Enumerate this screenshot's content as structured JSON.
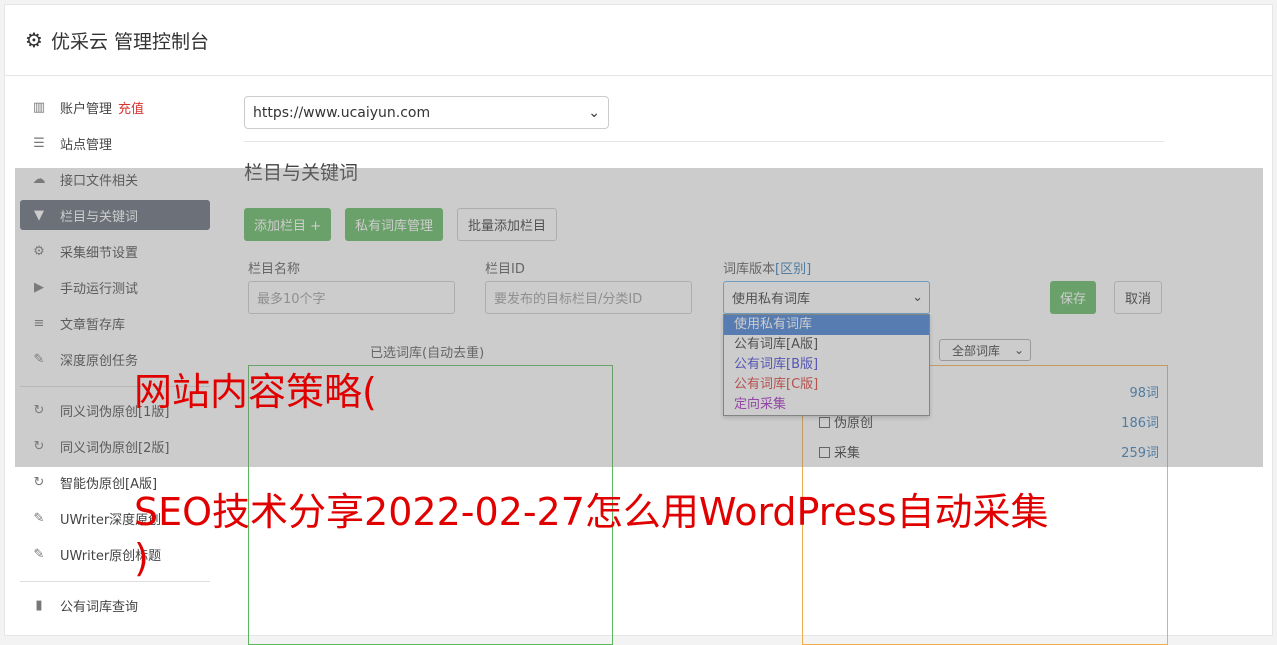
{
  "header": {
    "title": "优采云 管理控制台"
  },
  "sidebar": {
    "items": [
      {
        "label": "账户管理",
        "extra": "充值",
        "icon": "bar-chart-icon"
      },
      {
        "label": "站点管理",
        "icon": "server-icon"
      },
      {
        "label": "接口文件相关",
        "icon": "cloud-upload-icon"
      },
      {
        "label": "栏目与关键词",
        "icon": "filter-icon"
      },
      {
        "label": "采集细节设置",
        "icon": "gears-icon"
      },
      {
        "label": "手动运行测试",
        "icon": "play-circle-icon"
      },
      {
        "label": "文章暂存库",
        "icon": "database-icon"
      },
      {
        "label": "深度原创任务",
        "icon": "edit-icon"
      },
      {
        "label": "同义词伪原创[1版]",
        "icon": "refresh-icon"
      },
      {
        "label": "同义词伪原创[2版]",
        "icon": "refresh-icon"
      },
      {
        "label": "智能伪原创[A版]",
        "icon": "refresh-icon"
      },
      {
        "label": "UWriter深度原创",
        "icon": "edit-icon"
      },
      {
        "label": "UWriter原创标题",
        "icon": "edit-icon"
      },
      {
        "label": "公有词库查询",
        "icon": "book-icon"
      }
    ]
  },
  "main": {
    "site_select": "https://www.ucaiyun.com",
    "section_title": "栏目与关键词",
    "buttons": {
      "add_column": "添加栏目 +",
      "private_lib": "私有词库管理",
      "batch_add": "批量添加栏目"
    },
    "form": {
      "name_label": "栏目名称",
      "name_placeholder": "最多10个字",
      "id_label": "栏目ID",
      "id_placeholder": "要发布的目标栏目/分类ID",
      "version_label": "词库版本",
      "version_link": "[区别]",
      "version_value": "使用私有词库",
      "save": "保存",
      "cancel": "取消"
    },
    "version_options": [
      "使用私有词库",
      "公有词库[A版]",
      "公有词库[B版]",
      "公有词库[C版]",
      "定向采集"
    ],
    "selected_lib_title": "已选词库(自动去重)",
    "lib_filter": "全部词库",
    "libs": [
      {
        "name": "",
        "count": "98词"
      },
      {
        "name": "伪原创",
        "count": "186词"
      },
      {
        "name": "采集",
        "count": "259词"
      }
    ]
  },
  "caption": {
    "line1": "网站内容策略(",
    "line2": "SEO技术分享2022-02-27怎么用WordPress自动采集",
    "line3": ")"
  },
  "colors": {
    "accent": "#5cb85c",
    "active_nav": "#5e6775",
    "caption": "#e00000",
    "link": "#337ab7"
  }
}
